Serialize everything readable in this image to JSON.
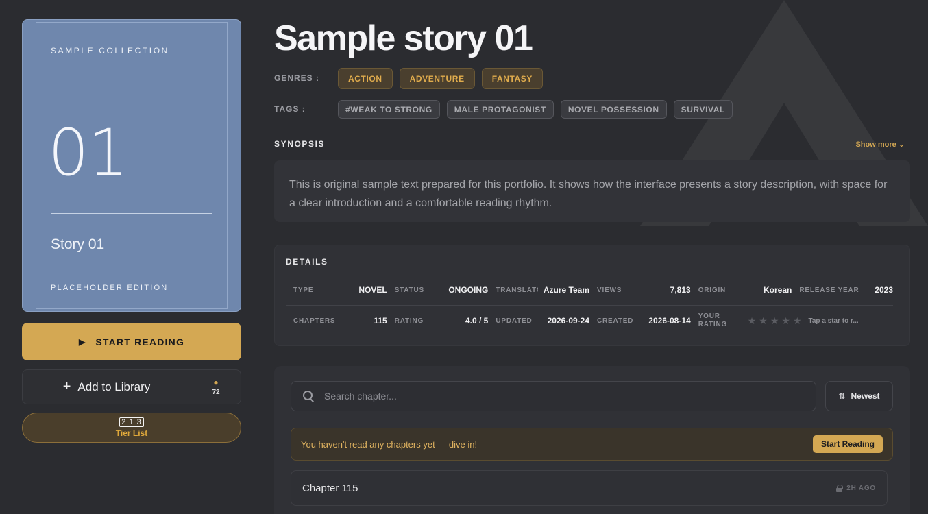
{
  "cover": {
    "collection": "SAMPLE COLLECTION",
    "number": "01",
    "story": "Story 01",
    "edition": "PLACEHOLDER EDITION"
  },
  "actions": {
    "start_reading": "START READING",
    "add_to_library": "Add to Library",
    "library_count": "72",
    "tier_icon": "2 1 3",
    "tier_list": "Tier List"
  },
  "title": "Sample story 01",
  "genres_label": "GENRES :",
  "genres": [
    "ACTION",
    "ADVENTURE",
    "FANTASY"
  ],
  "tags_label": "TAGS :",
  "tags": [
    "#WEAK TO STRONG",
    "MALE PROTAGONIST",
    "NOVEL POSSESSION",
    "SURVIVAL"
  ],
  "synopsis": {
    "label": "SYNOPSIS",
    "show_more": "Show more ⌄",
    "text": "This is original sample text prepared for this portfolio. It shows how the interface presents a story description, with space for a clear introduction and a comfortable reading rhythm."
  },
  "details": {
    "label": "DETAILS",
    "row1": [
      {
        "k": "TYPE",
        "v": "NOVEL"
      },
      {
        "k": "STATUS",
        "v": "ONGOING"
      },
      {
        "k": "TRANSLATOR",
        "v": "Azure Team"
      },
      {
        "k": "VIEWS",
        "v": "7,813"
      },
      {
        "k": "ORIGIN",
        "v": "Korean"
      },
      {
        "k": "RELEASE YEAR",
        "v": "2023"
      }
    ],
    "row2": [
      {
        "k": "CHAPTERS",
        "v": "115"
      },
      {
        "k": "RATING",
        "v": "4.0 / 5"
      },
      {
        "k": "UPDATED",
        "v": "2026-09-24"
      },
      {
        "k": "CREATED",
        "v": "2026-08-14"
      }
    ],
    "your_rating_label": "YOUR RATING",
    "your_rating_value": 0,
    "tap_hint": "Tap a star to r..."
  },
  "chapters": {
    "search_placeholder": "Search chapter...",
    "sort_label": "Newest",
    "notice": "You haven't read any chapters yet — dive in!",
    "notice_button": "Start Reading",
    "items": [
      {
        "title": "Chapter 115",
        "time": "2H AGO"
      }
    ]
  },
  "colors": {
    "accent": "#d4a853",
    "background": "#2b2c30",
    "cover": "#6f87ad"
  }
}
